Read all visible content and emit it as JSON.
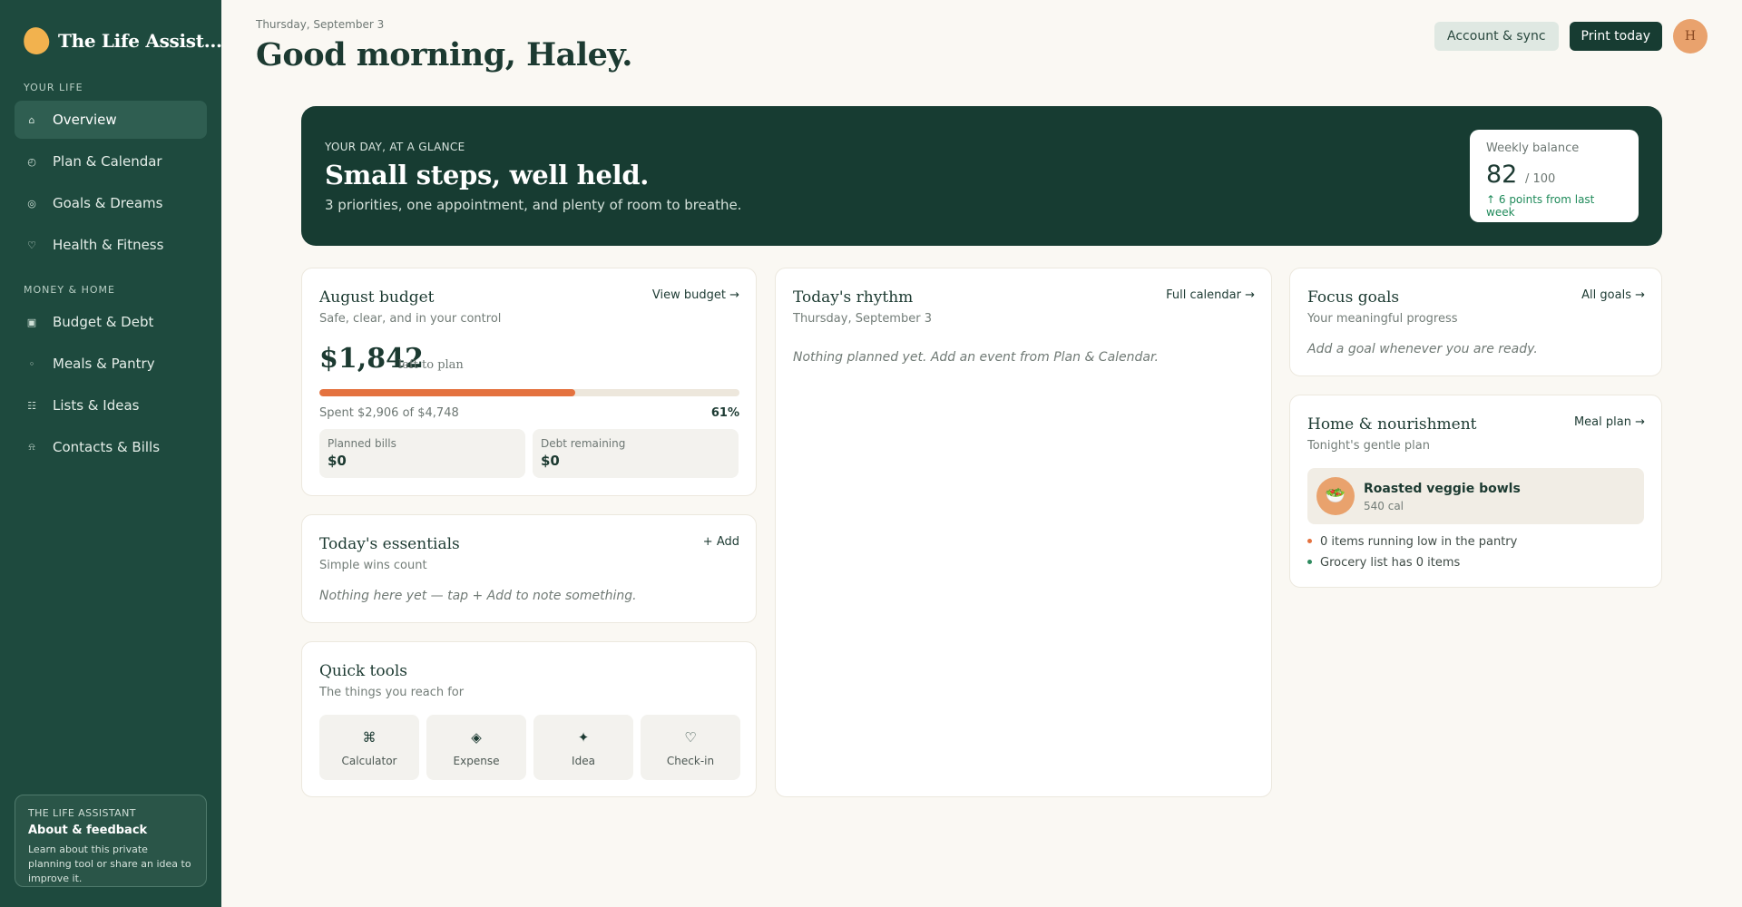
{
  "brand": {
    "name": "The Life Assist..."
  },
  "sidebar": {
    "sections": [
      {
        "label": "YOUR LIFE",
        "items": [
          {
            "label": "Overview",
            "icon": "home-icon",
            "glyph": "⌂",
            "active": true
          },
          {
            "label": "Plan & Calendar",
            "icon": "clock-icon",
            "glyph": "◴"
          },
          {
            "label": "Goals & Dreams",
            "icon": "target-icon",
            "glyph": "◎"
          },
          {
            "label": "Health & Fitness",
            "icon": "heart-icon",
            "glyph": "♡"
          }
        ]
      },
      {
        "label": "MONEY & HOME",
        "items": [
          {
            "label": "Budget & Debt",
            "icon": "wallet-icon",
            "glyph": "▣"
          },
          {
            "label": "Meals & Pantry",
            "icon": "dot-icon",
            "glyph": "◦"
          },
          {
            "label": "Lists & Ideas",
            "icon": "list-icon",
            "glyph": "☷"
          },
          {
            "label": "Contacts & Bills",
            "icon": "bell-icon",
            "glyph": "⍾"
          }
        ]
      }
    ],
    "about": {
      "kicker": "THE LIFE ASSISTANT",
      "title": "About & feedback",
      "text": "Learn about this private planning tool or share an idea to improve it."
    }
  },
  "header": {
    "date": "Thursday, September 3",
    "greeting": "Good morning, Haley.",
    "account_label": "Account & sync",
    "print_label": "Print today",
    "avatar_initial": "H"
  },
  "hero": {
    "kicker": "YOUR DAY, AT A GLANCE",
    "title": "Small steps, well held.",
    "subtitle": "3 priorities, one appointment, and plenty of room to breathe.",
    "balance": {
      "label": "Weekly balance",
      "value": "82",
      "max": "/ 100",
      "delta": "↑ 6 points from last week"
    }
  },
  "budget": {
    "title": "August budget",
    "subtitle": "Safe, clear, and in your control",
    "link": "View budget →",
    "amount": "$1,842",
    "amount_note": "left to plan",
    "progress": 0.61,
    "spent_text": "Spent $2,906 of $4,748",
    "percent": "61%",
    "planned_bills_label": "Planned bills",
    "planned_bills_value": "$0",
    "debt_label": "Debt remaining",
    "debt_value": "$0"
  },
  "essentials": {
    "title": "Today's essentials",
    "subtitle": "Simple wins count",
    "link": "+ Add",
    "empty": "Nothing here yet — tap + Add to note something."
  },
  "tools": {
    "title": "Quick tools",
    "subtitle": "The things you reach for",
    "items": [
      {
        "label": "Calculator",
        "glyph": "⌘",
        "icon": "calculator-icon"
      },
      {
        "label": "Expense",
        "glyph": "◈",
        "icon": "expense-icon"
      },
      {
        "label": "Idea",
        "glyph": "✦",
        "icon": "sparkle-icon"
      },
      {
        "label": "Check-in",
        "glyph": "♡",
        "icon": "heart-icon"
      }
    ]
  },
  "rhythm": {
    "title": "Today's rhythm",
    "subtitle": "Thursday, September 3",
    "link": "Full calendar →",
    "empty": "Nothing planned yet. Add an event from Plan & Calendar."
  },
  "goals": {
    "title": "Focus goals",
    "subtitle": "Your meaningful progress",
    "link": "All goals →",
    "empty": "Add a goal whenever you are ready."
  },
  "home": {
    "title": "Home & nourishment",
    "subtitle": "Tonight's gentle plan",
    "link": "Meal plan →",
    "meal_name": "Roasted veggie bowls",
    "meal_cal": "540 cal",
    "meal_glyph": "🥗",
    "pantry_note": "0 items running low in the pantry",
    "grocery_note": "Grocery list has 0 items",
    "colors": {
      "pantry_dot": "#e4723f",
      "grocery_dot": "#2e8a5e"
    }
  }
}
